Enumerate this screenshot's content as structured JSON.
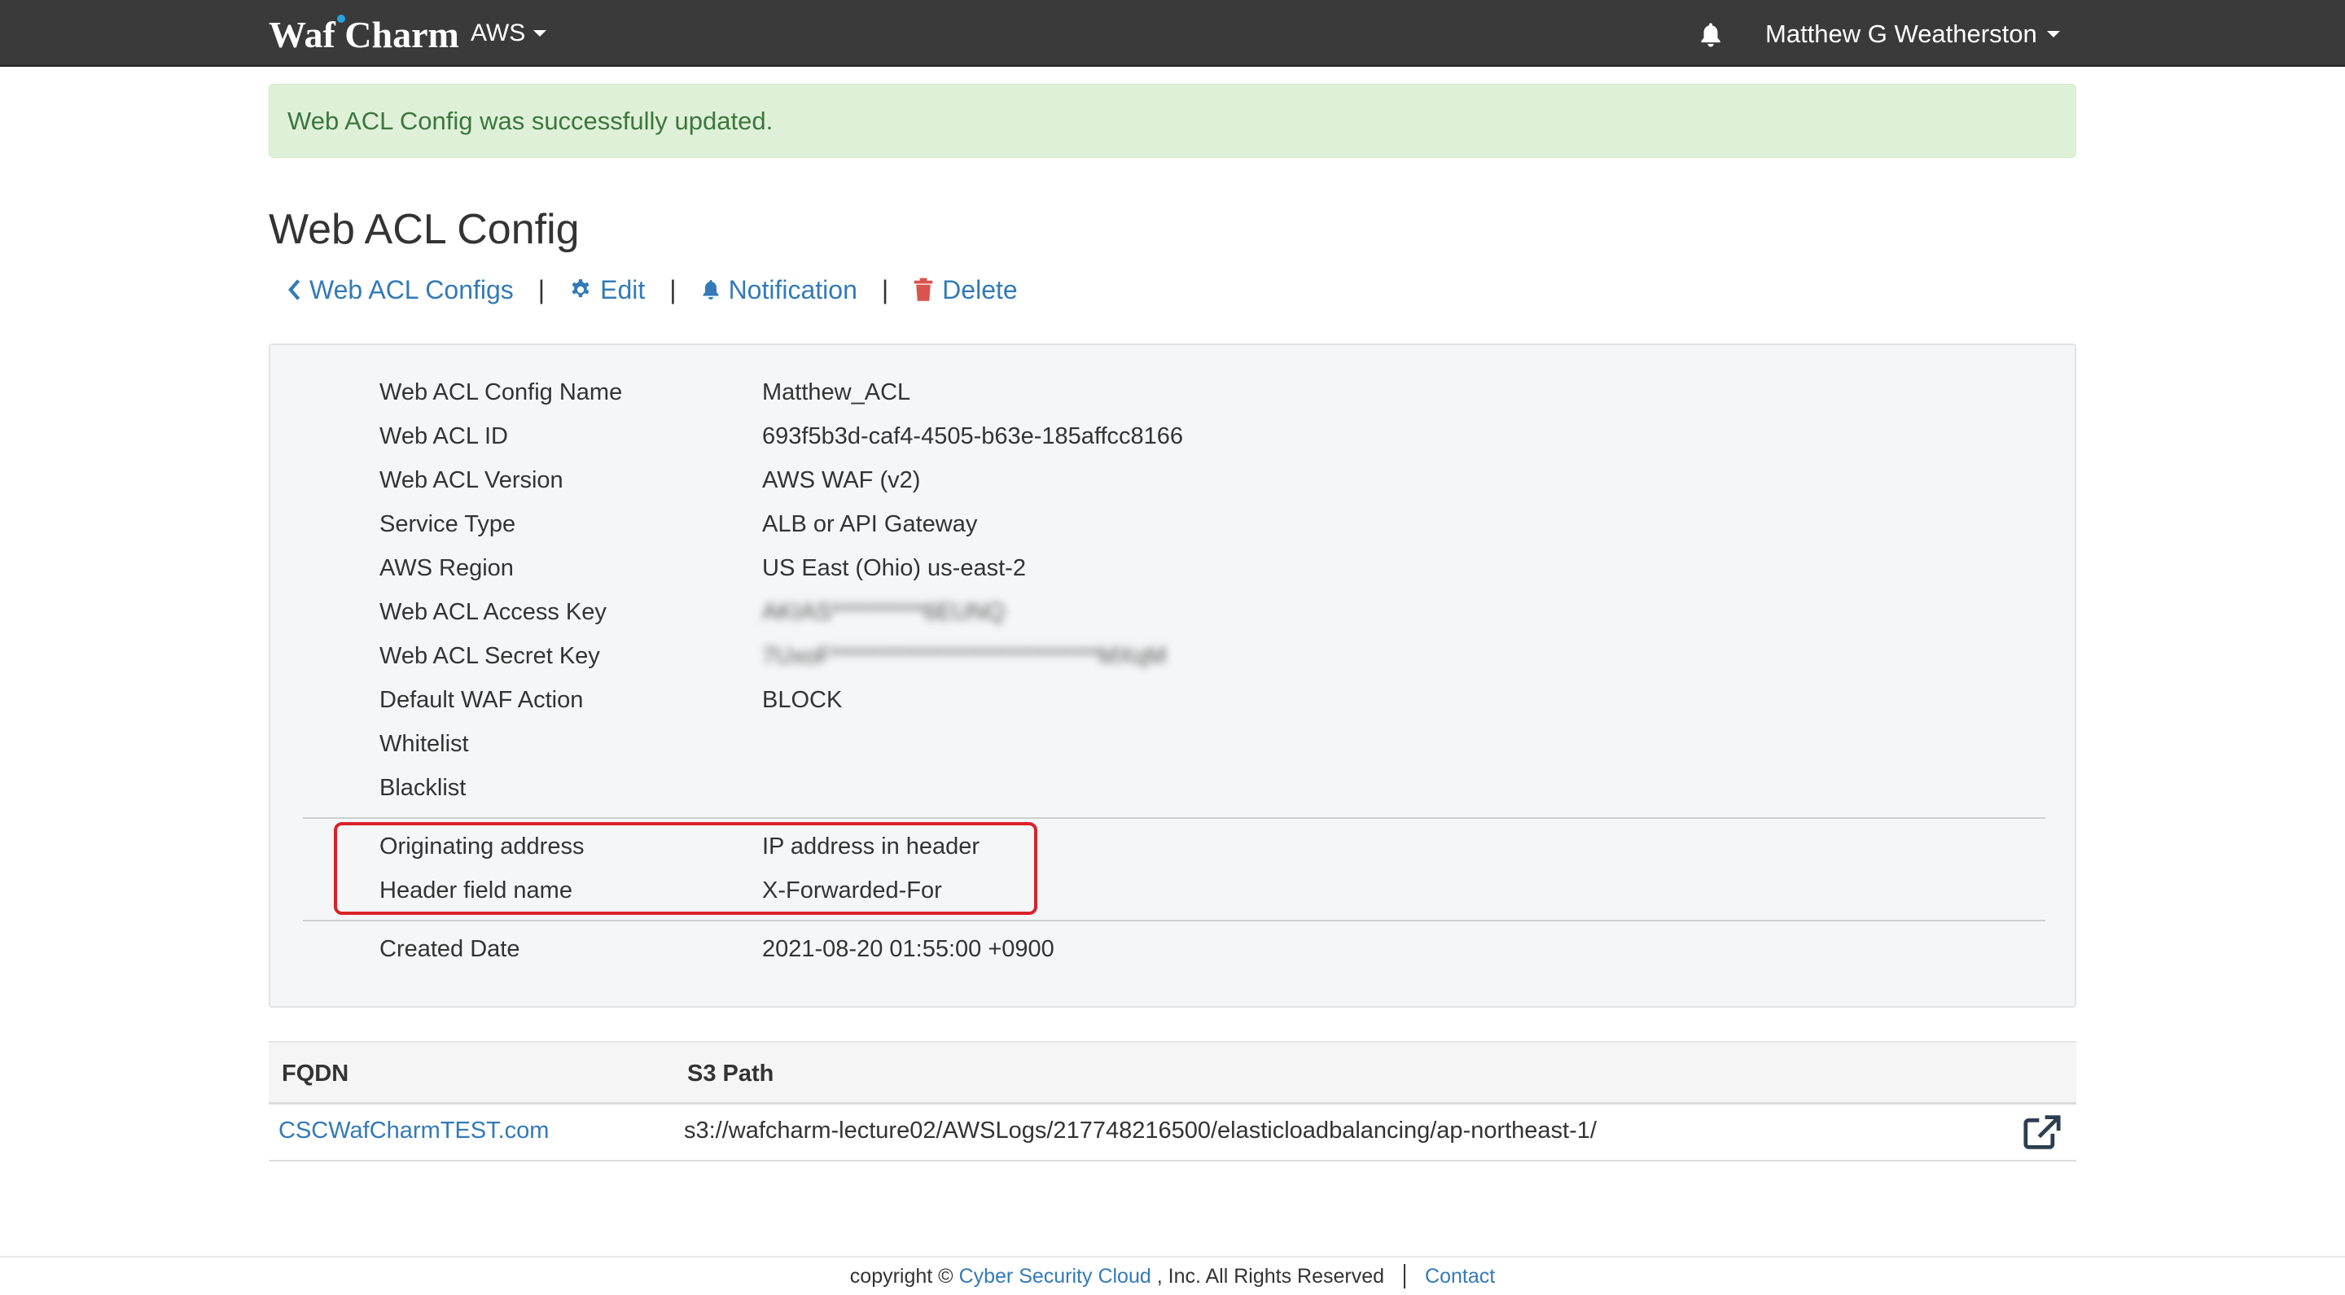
{
  "navbar": {
    "brand": "Waf Charm",
    "platform_menu": "AWS",
    "user_menu": "Matthew G Weatherston"
  },
  "alert": {
    "message": "Web ACL Config was successfully updated."
  },
  "page": {
    "title": "Web ACL Config"
  },
  "actions": {
    "back_label": "Web ACL Configs",
    "edit_label": "Edit",
    "notification_label": "Notification",
    "delete_label": "Delete",
    "separator": "|"
  },
  "details": {
    "rows": [
      {
        "label": "Web ACL Config Name",
        "value": "Matthew_ACL"
      },
      {
        "label": "Web ACL ID",
        "value": "693f5b3d-caf4-4505-b63e-185affcc8166"
      },
      {
        "label": "Web ACL Version",
        "value": "AWS WAF (v2)"
      },
      {
        "label": "Service Type",
        "value": "ALB or API Gateway"
      },
      {
        "label": "AWS Region",
        "value": "US East (Ohio) us-east-2"
      },
      {
        "label": "Web ACL Access Key",
        "value": "AKIAS**********6EUNQ"
      },
      {
        "label": "Web ACL Secret Key",
        "value": "7UxoF*****************************MXqM"
      },
      {
        "label": "Default WAF Action",
        "value": "BLOCK"
      },
      {
        "label": "Whitelist",
        "value": ""
      },
      {
        "label": "Blacklist",
        "value": ""
      }
    ],
    "highlighted_rows": [
      {
        "label": "Originating address",
        "value": "IP address in header"
      },
      {
        "label": "Header field name",
        "value": "X-Forwarded-For"
      }
    ],
    "created": {
      "label": "Created Date",
      "value": "2021-08-20 01:55:00 +0900"
    }
  },
  "log_table": {
    "columns": [
      "FQDN",
      "S3 Path"
    ],
    "rows": [
      {
        "fqdn": "CSCWafCharmTEST.com",
        "s3_path": "s3://wafcharm-lecture02/AWSLogs/217748216500/elasticloadbalancing/ap-northeast-1/"
      }
    ]
  },
  "footer": {
    "copyright_prefix": "copyright ©",
    "company_link": "Cyber Security Cloud",
    "copyright_suffix": ", Inc. All Rights Reserved",
    "contact_link": "Contact"
  },
  "colors": {
    "navbar_bg": "#3a3a3a",
    "link": "#337ab7",
    "alert_bg": "#dff0d8",
    "alert_text": "#3c763d",
    "delete_icon": "#d9534f",
    "highlight_border": "#d9222a"
  },
  "icons": {
    "back": "chevron-left-icon",
    "edit": "gear-icon",
    "notification": "bell-icon",
    "delete": "trash-icon",
    "external": "external-link-icon",
    "nav_bell": "bell-icon"
  }
}
